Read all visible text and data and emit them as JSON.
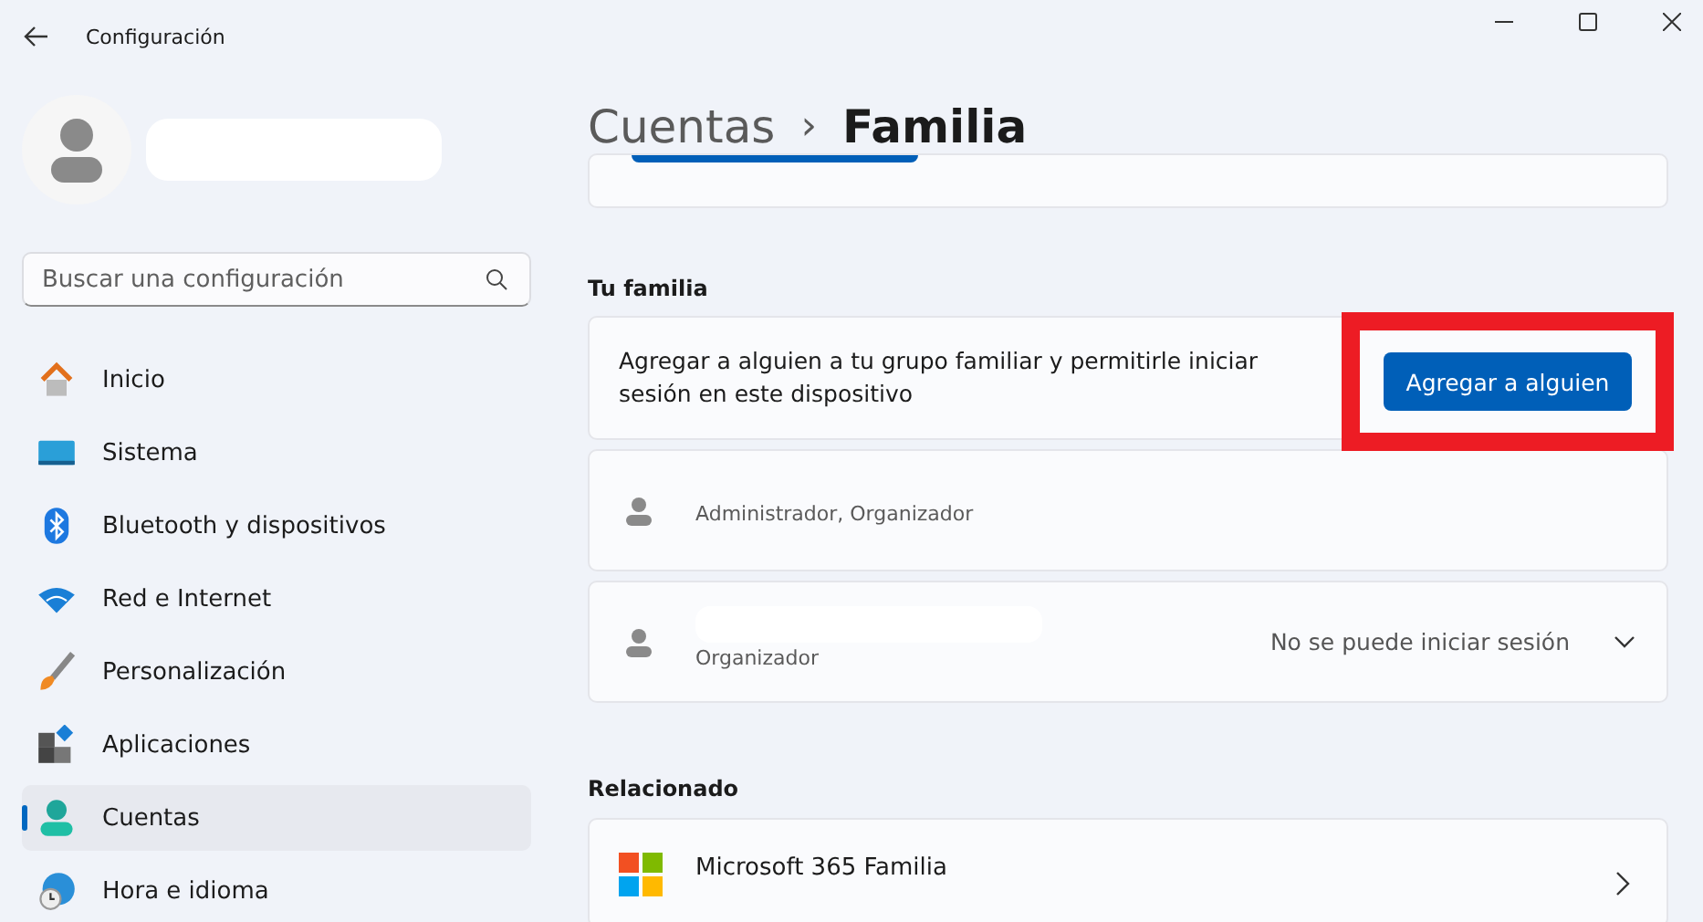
{
  "window": {
    "title": "Configuración"
  },
  "search": {
    "placeholder": "Buscar una configuración"
  },
  "nav": [
    {
      "label": "Inicio",
      "selected": false
    },
    {
      "label": "Sistema",
      "selected": false
    },
    {
      "label": "Bluetooth y dispositivos",
      "selected": false
    },
    {
      "label": "Red e Internet",
      "selected": false
    },
    {
      "label": "Personalización",
      "selected": false
    },
    {
      "label": "Aplicaciones",
      "selected": false
    },
    {
      "label": "Cuentas",
      "selected": true
    },
    {
      "label": "Hora e idioma",
      "selected": false
    }
  ],
  "breadcrumb": {
    "parent": "Cuentas",
    "separator": "›",
    "current": "Familia"
  },
  "family": {
    "heading": "Tu familia",
    "description": "Agregar a alguien a tu grupo familiar y permitirle iniciar sesión en este dispositivo",
    "button": {
      "label": "Agregar a alguien",
      "highlighted": true
    },
    "members": [
      {
        "name_redacted": false,
        "role": "Administrador, Organizador"
      },
      {
        "name_redacted": true,
        "role": "Organizador",
        "status": "No se puede iniciar sesión"
      }
    ]
  },
  "related": {
    "heading": "Relacionado",
    "items": [
      {
        "title": "Microsoft 365 Familia"
      }
    ]
  }
}
